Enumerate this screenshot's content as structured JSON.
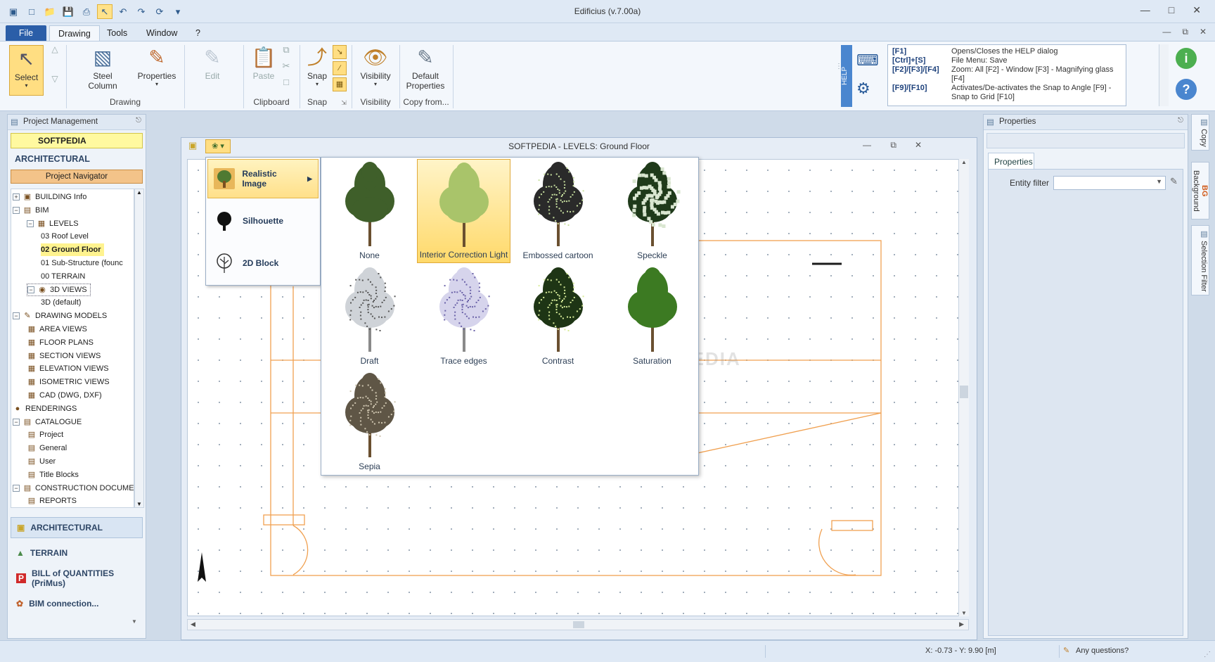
{
  "app": {
    "title": "Edificius (v.7.00a)"
  },
  "ribbon": {
    "tabs": [
      "File",
      "Drawing",
      "Tools",
      "Window",
      "?"
    ],
    "buttons": {
      "select": "Select",
      "steel_column_1": "Steel",
      "steel_column_2": "Column",
      "properties": "Properties",
      "edit": "Edit",
      "paste": "Paste",
      "snap": "Snap",
      "visibility": "Visibility",
      "default_props_1": "Default",
      "default_props_2": "Properties"
    },
    "groups": {
      "drawing": "Drawing",
      "clipboard": "Clipboard",
      "snap": "Snap",
      "visibility": "Visibility",
      "copy_from": "Copy from..."
    }
  },
  "help": {
    "strip": "HELP",
    "rows": [
      {
        "key": "[F1]",
        "desc": "Opens/Closes the HELP dialog"
      },
      {
        "key": "[Ctrl]+[S]",
        "desc": "File Menu: Save"
      },
      {
        "key": "[F2]/[F3]/[F4]",
        "desc": "Zoom: All [F2] - Window [F3] - Magnifying glass [F4]"
      },
      {
        "key": "[F9]/[F10]",
        "desc": "Activates/De-activates the Snap to Angle [F9] - Snap to Grid [F10]"
      }
    ]
  },
  "left_panel": {
    "title": "Project Management",
    "project": "SOFTPEDIA",
    "section": "ARCHITECTURAL",
    "navigator": "Project Navigator",
    "tree": [
      "BUILDING Info",
      "BIM",
      "LEVELS",
      "03 Roof Level",
      "02 Ground Floor",
      "01 Sub-Structure (founc",
      "00 TERRAIN",
      "3D VIEWS",
      "3D (default)",
      "DRAWING MODELS",
      "AREA VIEWS",
      "FLOOR PLANS",
      "SECTION VIEWS",
      "ELEVATION VIEWS",
      "ISOMETRIC VIEWS",
      "CAD (DWG, DXF)",
      "RENDERINGS",
      "CATALOGUE",
      "Project",
      "General",
      "User",
      "Title Blocks",
      "CONSTRUCTION DOCUMEN",
      "REPORTS"
    ],
    "modules": [
      "ARCHITECTURAL",
      "TERRAIN",
      "BILL of QUANTITIES (PriMus)",
      "BIM connection..."
    ]
  },
  "drawing_window": {
    "title": "SOFTPEDIA -  LEVELS: Ground Floor",
    "watermark": "SOFTPEDIA"
  },
  "render_menu": {
    "items": [
      "Realistic Image",
      "Silhouette",
      "2D Block"
    ]
  },
  "tree_styles": {
    "items": [
      {
        "label": "None",
        "leaf": "#3f5f2a",
        "dots": ""
      },
      {
        "label": "Interior Correction Light",
        "leaf": "#a9c46a",
        "dots": ""
      },
      {
        "label": "Embossed cartoon",
        "leaf": "#2a2a2a",
        "dots": "#c8e0a0"
      },
      {
        "label": "Speckle",
        "leaf": "#1f3a1a",
        "dots": "#d9e6d0"
      },
      {
        "label": "Draft",
        "leaf": "#cfd3d8",
        "dots": "#555555"
      },
      {
        "label": "Trace edges",
        "leaf": "#d6d4ec",
        "dots": "#6b63a8"
      },
      {
        "label": "Contrast",
        "leaf": "#1e3515",
        "dots": "#d8ec9a"
      },
      {
        "label": "Saturation",
        "leaf": "#3c7a22",
        "dots": ""
      },
      {
        "label": "Sepia",
        "leaf": "#5f5646",
        "dots": "#cfc6b0"
      }
    ],
    "selected": "Interior Correction Light"
  },
  "right_panel": {
    "title": "Properties",
    "tab": "Properties",
    "entity_filter_label": "Entity filter",
    "side_tabs": [
      "Copy",
      "Background",
      "Selection Filter"
    ]
  },
  "status": {
    "coords": "X: -0.73 - Y: 9.90 [m]",
    "questions": "Any questions?"
  },
  "colors": {
    "accent": "#2b5ea8",
    "highlight": "#ffde82",
    "plan_line": "#f0a050"
  }
}
